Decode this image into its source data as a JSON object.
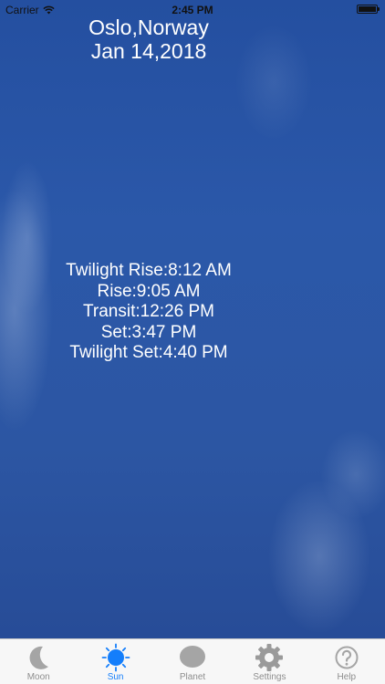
{
  "status_bar": {
    "carrier": "Carrier",
    "time": "2:45 PM",
    "battery_level": 1.0
  },
  "header": {
    "location": "Oslo,Norway",
    "date": "Jan 14,2018"
  },
  "sun_times": {
    "twilight_rise": "Twilight Rise:8:12 AM",
    "rise": "Rise:9:05 AM",
    "transit": "Transit:12:26 PM",
    "set": "Set:3:47 PM",
    "twilight_set": "Twilight Set:4:40 PM"
  },
  "tabs": [
    {
      "label": "Moon",
      "icon": "moon-icon"
    },
    {
      "label": "Sun",
      "icon": "sun-icon",
      "active": true
    },
    {
      "label": "Planet",
      "icon": "planet-icon"
    },
    {
      "label": "Settings",
      "icon": "gear-icon"
    },
    {
      "label": "Help",
      "icon": "help-icon"
    }
  ],
  "colors": {
    "active_tab": "#147efb",
    "inactive_tab": "#8e8e8e",
    "sky": "#2c56a3"
  }
}
